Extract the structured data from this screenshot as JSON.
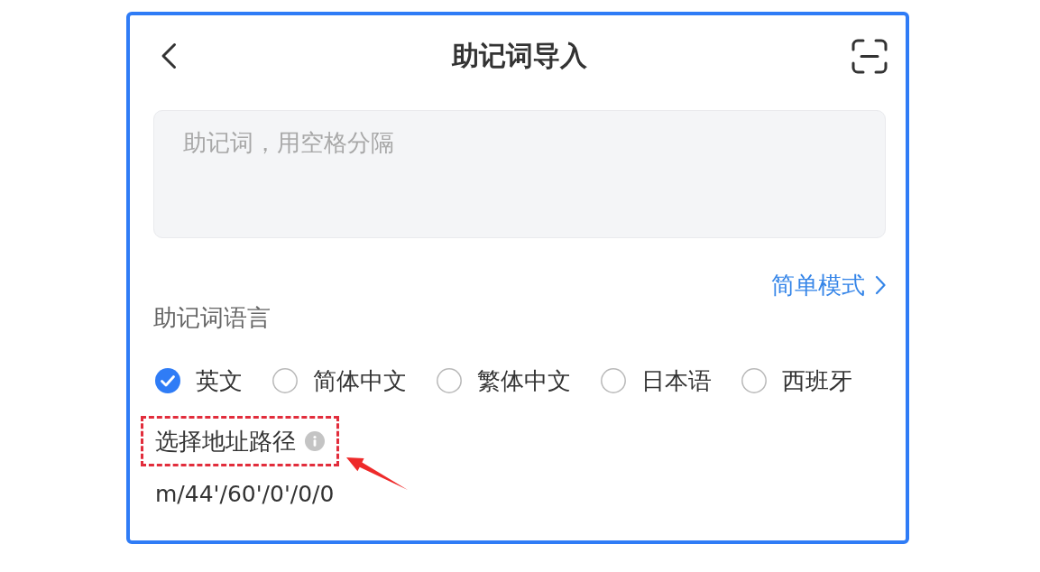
{
  "header": {
    "title": "助记词导入"
  },
  "mnemonic_input": {
    "placeholder": "助记词，用空格分隔"
  },
  "mode_link": {
    "label": "简单模式"
  },
  "language_section": {
    "label": "助记词语言",
    "options": [
      {
        "label": "英文",
        "selected": true
      },
      {
        "label": "简体中文",
        "selected": false
      },
      {
        "label": "繁体中文",
        "selected": false
      },
      {
        "label": "日本语",
        "selected": false
      },
      {
        "label": "西班牙",
        "selected": false
      }
    ]
  },
  "address_path": {
    "label": "选择地址路径",
    "value": "m/44'/60'/0'/0/0",
    "highlighted": true
  }
}
